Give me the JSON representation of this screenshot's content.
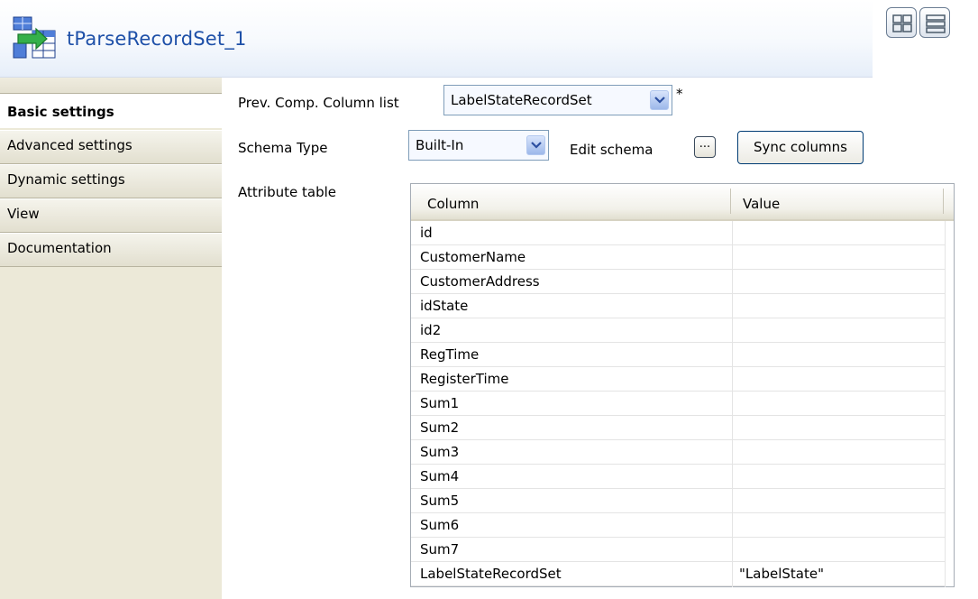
{
  "header": {
    "title": "tParseRecordSet_1"
  },
  "tabs": [
    {
      "label": "Basic settings"
    },
    {
      "label": "Advanced settings"
    },
    {
      "label": "Dynamic settings"
    },
    {
      "label": "View"
    },
    {
      "label": "Documentation"
    }
  ],
  "form": {
    "prev_comp_label": "Prev. Comp. Column list",
    "prev_comp_value": "LabelStateRecordSet",
    "required_marker": "*",
    "schema_type_label": "Schema Type",
    "schema_type_value": "Built-In",
    "edit_schema_label": "Edit schema",
    "edit_schema_button": "...",
    "sync_columns_label": "Sync columns",
    "attribute_table_label": "Attribute table"
  },
  "table": {
    "columns": [
      "Column",
      "Value"
    ],
    "rows": [
      {
        "column": "id",
        "value": ""
      },
      {
        "column": "CustomerName",
        "value": ""
      },
      {
        "column": "CustomerAddress",
        "value": ""
      },
      {
        "column": "idState",
        "value": ""
      },
      {
        "column": "id2",
        "value": ""
      },
      {
        "column": "RegTime",
        "value": ""
      },
      {
        "column": "RegisterTime",
        "value": ""
      },
      {
        "column": "Sum1",
        "value": ""
      },
      {
        "column": "Sum2",
        "value": ""
      },
      {
        "column": "Sum3",
        "value": ""
      },
      {
        "column": "Sum4",
        "value": ""
      },
      {
        "column": "Sum5",
        "value": ""
      },
      {
        "column": "Sum6",
        "value": ""
      },
      {
        "column": "Sum7",
        "value": ""
      },
      {
        "column": "LabelStateRecordSet",
        "value": "\"LabelState\""
      }
    ]
  },
  "colors": {
    "title": "#1e50a8",
    "tab_bg": "#ece9d8",
    "combo_border": "#7f9db9"
  }
}
